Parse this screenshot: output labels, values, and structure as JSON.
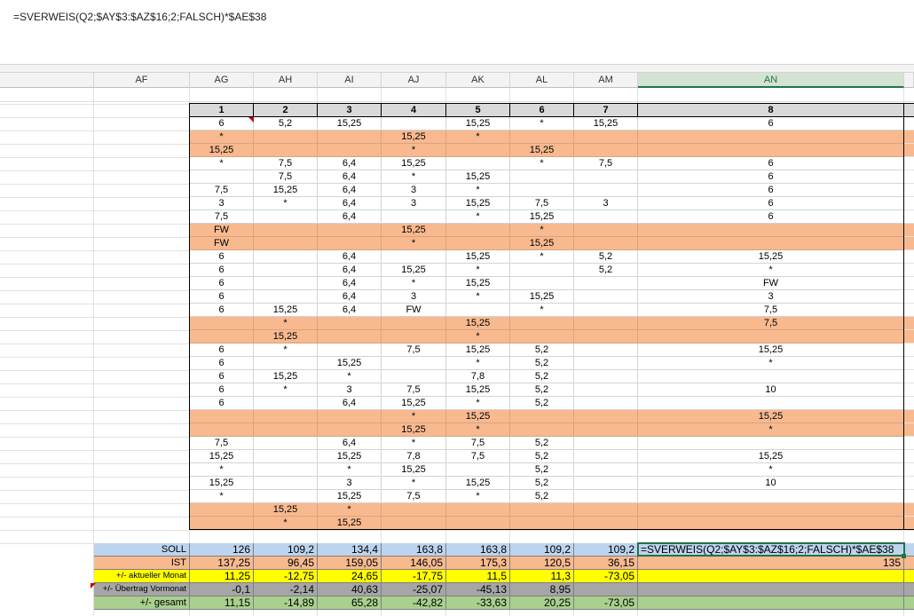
{
  "formula": "=SVERWEIS(Q2;$AY$3:$AZ$16;2;FALSCH)*$AE$38",
  "columns": [
    "AF",
    "AG",
    "AH",
    "AI",
    "AJ",
    "AK",
    "AL",
    "AM",
    "AN"
  ],
  "selected_column": "AN",
  "headers": [
    "1",
    "2",
    "3",
    "4",
    "5",
    "6",
    "7",
    "8"
  ],
  "colors": {
    "orange": "#f8b98f",
    "blue": "#bdd4ee",
    "yellow": "#ffff00",
    "gray": "#a6a6a6",
    "green": "#a9d08e",
    "header_gray": "#d9d9d9",
    "selection": "#217346",
    "comment": "#c00000"
  },
  "rows": [
    {
      "c": [
        "6",
        "5,2",
        "15,25",
        "",
        "15,25",
        "*",
        "15,25",
        "6"
      ],
      "o": false
    },
    {
      "c": [
        "*",
        "",
        "",
        "15,25",
        "*",
        "",
        "",
        ""
      ],
      "o": true
    },
    {
      "c": [
        "15,25",
        "",
        "",
        "*",
        "",
        "15,25",
        "",
        ""
      ],
      "o": true
    },
    {
      "c": [
        "*",
        "7,5",
        "6,4",
        "15,25",
        "",
        "*",
        "7,5",
        "6"
      ],
      "o": false
    },
    {
      "c": [
        "",
        "7,5",
        "6,4",
        "*",
        "15,25",
        "",
        "",
        "6"
      ],
      "o": false
    },
    {
      "c": [
        "7,5",
        "15,25",
        "6,4",
        "3",
        "*",
        "",
        "",
        "6"
      ],
      "o": false
    },
    {
      "c": [
        "3",
        "*",
        "6,4",
        "3",
        "15,25",
        "7,5",
        "3",
        "6"
      ],
      "o": false
    },
    {
      "c": [
        "7,5",
        "",
        "6,4",
        "",
        "*",
        "15,25",
        "",
        "6"
      ],
      "o": false
    },
    {
      "c": [
        "FW",
        "",
        "",
        "15,25",
        "",
        "*",
        "",
        ""
      ],
      "o": true
    },
    {
      "c": [
        "FW",
        "",
        "",
        "*",
        "",
        "15,25",
        "",
        ""
      ],
      "o": true
    },
    {
      "c": [
        "6",
        "",
        "6,4",
        "",
        "15,25",
        "*",
        "5,2",
        "15,25"
      ],
      "o": false
    },
    {
      "c": [
        "6",
        "",
        "6,4",
        "15,25",
        "*",
        "",
        "5,2",
        "*"
      ],
      "o": false
    },
    {
      "c": [
        "6",
        "",
        "6,4",
        "*",
        "15,25",
        "",
        "",
        "FW"
      ],
      "o": false
    },
    {
      "c": [
        "6",
        "",
        "6,4",
        "3",
        "*",
        "15,25",
        "",
        "3"
      ],
      "o": false
    },
    {
      "c": [
        "6",
        "15,25",
        "6,4",
        "FW",
        "",
        "*",
        "",
        "7,5"
      ],
      "o": false
    },
    {
      "c": [
        "",
        "*",
        "",
        "",
        "15,25",
        "",
        "",
        "7,5"
      ],
      "o": true
    },
    {
      "c": [
        "",
        "15,25",
        "",
        "",
        "*",
        "",
        "",
        ""
      ],
      "o": true
    },
    {
      "c": [
        "6",
        "*",
        "",
        "7,5",
        "15,25",
        "5,2",
        "",
        "15,25"
      ],
      "o": false
    },
    {
      "c": [
        "6",
        "",
        "15,25",
        "",
        "*",
        "5,2",
        "",
        "*"
      ],
      "o": false
    },
    {
      "c": [
        "6",
        "15,25",
        "*",
        "",
        "7,8",
        "5,2",
        "",
        ""
      ],
      "o": false
    },
    {
      "c": [
        "6",
        "*",
        "3",
        "7,5",
        "15,25",
        "5,2",
        "",
        "10"
      ],
      "o": false
    },
    {
      "c": [
        "6",
        "",
        "6,4",
        "15,25",
        "*",
        "5,2",
        "",
        ""
      ],
      "o": false
    },
    {
      "c": [
        "",
        "",
        "",
        "*",
        "15,25",
        "",
        "",
        "15,25"
      ],
      "o": true
    },
    {
      "c": [
        "",
        "",
        "",
        "15,25",
        "*",
        "",
        "",
        "*"
      ],
      "o": true
    },
    {
      "c": [
        "7,5",
        "",
        "6,4",
        "*",
        "7,5",
        "5,2",
        "",
        ""
      ],
      "o": false
    },
    {
      "c": [
        "15,25",
        "",
        "15,25",
        "7,8",
        "7,5",
        "5,2",
        "",
        "15,25"
      ],
      "o": false
    },
    {
      "c": [
        "*",
        "",
        "*",
        "15,25",
        "",
        "5,2",
        "",
        "*"
      ],
      "o": false
    },
    {
      "c": [
        "15,25",
        "",
        "3",
        "*",
        "15,25",
        "5,2",
        "",
        "10"
      ],
      "o": false
    },
    {
      "c": [
        "*",
        "",
        "15,25",
        "7,5",
        "*",
        "5,2",
        "",
        ""
      ],
      "o": false
    },
    {
      "c": [
        "",
        "15,25",
        "*",
        "",
        "",
        "",
        "",
        ""
      ],
      "o": true
    },
    {
      "c": [
        "",
        "*",
        "15,25",
        "",
        "",
        "",
        "",
        ""
      ],
      "o": true
    }
  ],
  "summary": [
    {
      "label": "SOLL",
      "color": "blue",
      "vals": [
        "126",
        "109,2",
        "134,4",
        "163,8",
        "163,8",
        "109,2",
        "109,2"
      ],
      "an": "=SVERWEIS(Q2;$AY$3:$AZ$16;2;FALSCH)*$AE$38",
      "an_align": "left"
    },
    {
      "label": "IST",
      "color": "orange",
      "vals": [
        "137,25",
        "96,45",
        "159,05",
        "146,05",
        "175,3",
        "120,5",
        "36,15"
      ],
      "an": "135",
      "an_align": "right"
    },
    {
      "label": "+/- aktueller Monat",
      "color": "yellow",
      "vals": [
        "11,25",
        "-12,75",
        "24,65",
        "-17,75",
        "11,5",
        "11,3",
        "-73,05"
      ],
      "an": "",
      "an_align": "right"
    },
    {
      "label": "+/- Übertrag Vormonat",
      "color": "gray",
      "vals": [
        "-0,1",
        "-2,14",
        "40,63",
        "-25,07",
        "-45,13",
        "8,95",
        ""
      ],
      "an": "",
      "an_align": "right"
    },
    {
      "label": "+/- gesamt",
      "color": "green",
      "vals": [
        "11,15",
        "-14,89",
        "65,28",
        "-42,82",
        "-33,63",
        "20,25",
        "-73,05"
      ],
      "an": "",
      "an_align": "right"
    }
  ]
}
